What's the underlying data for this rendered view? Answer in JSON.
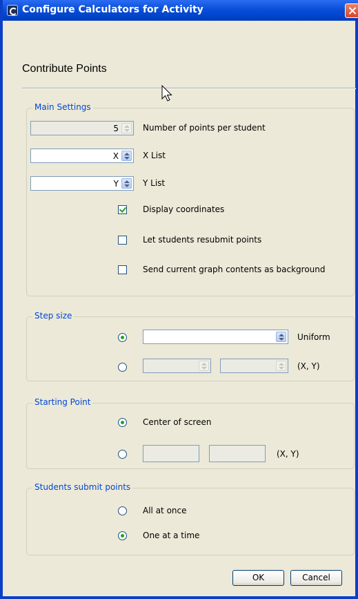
{
  "window": {
    "title": "Configure Calculators for Activity"
  },
  "heading": "Contribute Points",
  "main_settings": {
    "legend": "Main Settings",
    "points_value": "5",
    "points_label": "Number of points per student",
    "x_value": "X",
    "x_label": "X List",
    "y_value": "Y",
    "y_label": "Y List",
    "display_coords_label": "Display coordinates",
    "display_coords_checked": true,
    "resubmit_label": "Let students resubmit points",
    "resubmit_checked": false,
    "send_graph_label": "Send current graph contents as background",
    "send_graph_checked": false
  },
  "step_size": {
    "legend": "Step size",
    "uniform_label": "Uniform",
    "xy_label": "(X, Y)",
    "selected": "Uniform"
  },
  "starting_point": {
    "legend": "Starting Point",
    "center_label": "Center of screen",
    "xy_label": "(X, Y)",
    "selected": "Center of screen"
  },
  "submit": {
    "legend": "Students submit points",
    "all_label": "All at once",
    "one_label": "One at a time",
    "selected": "One at a time"
  },
  "buttons": {
    "ok": "OK",
    "cancel": "Cancel"
  },
  "icons": [
    "app-icon",
    "close-icon",
    "mouse-cursor-icon",
    "spinner-arrows-icon",
    "check-icon",
    "radio-dot-icon"
  ],
  "colors": {
    "title_bar": "#0a4fd8",
    "legend_text": "#0046d5",
    "dialog_bg": "#ece9d8",
    "check_mark": "#21a121"
  }
}
